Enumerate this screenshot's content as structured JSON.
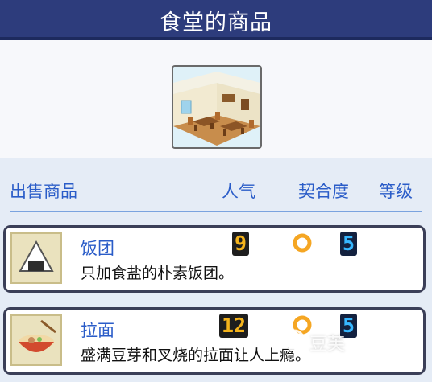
{
  "header": {
    "title": "食堂的商品"
  },
  "hero": {
    "icon": "cafeteria-room-image"
  },
  "columns": {
    "product": "出售商品",
    "popularity": "人气",
    "fit": "契合度",
    "level": "等级"
  },
  "items": [
    {
      "name": "饭团",
      "desc": "只加食盐的朴素饭团。",
      "popularity": "9",
      "level": "5",
      "icon": "rice-ball-icon",
      "fit_icon": "ring-icon"
    },
    {
      "name": "拉面",
      "desc": "盛满豆芽和叉烧的拉面让人上瘾。",
      "popularity": "12",
      "level": "5",
      "icon": "ramen-bowl-icon",
      "fit_icon": "ring-icon"
    }
  ],
  "colors": {
    "title_bar": "#2d3c7c",
    "header_text": "#2a5cc8",
    "popularity": "#f4b31b",
    "level": "#37b7ff",
    "ring": "#f5a623"
  },
  "watermark": {
    "text": "豆芙"
  }
}
